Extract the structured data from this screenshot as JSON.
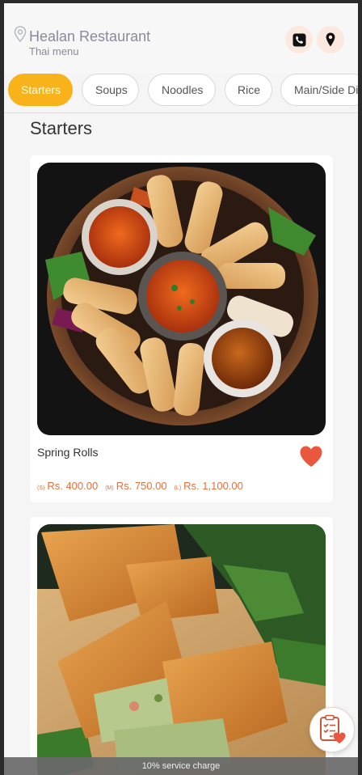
{
  "header": {
    "title": "Healan Restaurant",
    "subtitle": "Thai menu",
    "phone_icon": "phone-icon",
    "location_icon": "location-pin-icon"
  },
  "tabs": [
    {
      "label": "Starters",
      "active": true
    },
    {
      "label": "Soups",
      "active": false
    },
    {
      "label": "Noodles",
      "active": false
    },
    {
      "label": "Rice",
      "active": false
    },
    {
      "label": "Main/Side Di",
      "active": false
    }
  ],
  "section": {
    "title": "Starters"
  },
  "items": [
    {
      "name": "Spring Rolls",
      "favorite": true,
      "prices": [
        {
          "size": "(S)",
          "amount": "Rs. 400.00"
        },
        {
          "size": "(M)",
          "amount": "Rs. 750.00"
        },
        {
          "size": "(L)",
          "amount": "Rs. 1,100.00"
        }
      ]
    }
  ],
  "footer": {
    "text": "10% service charge"
  },
  "colors": {
    "accent": "#f8b21a",
    "price": "#e96f3a",
    "heart": "#e9573f"
  }
}
